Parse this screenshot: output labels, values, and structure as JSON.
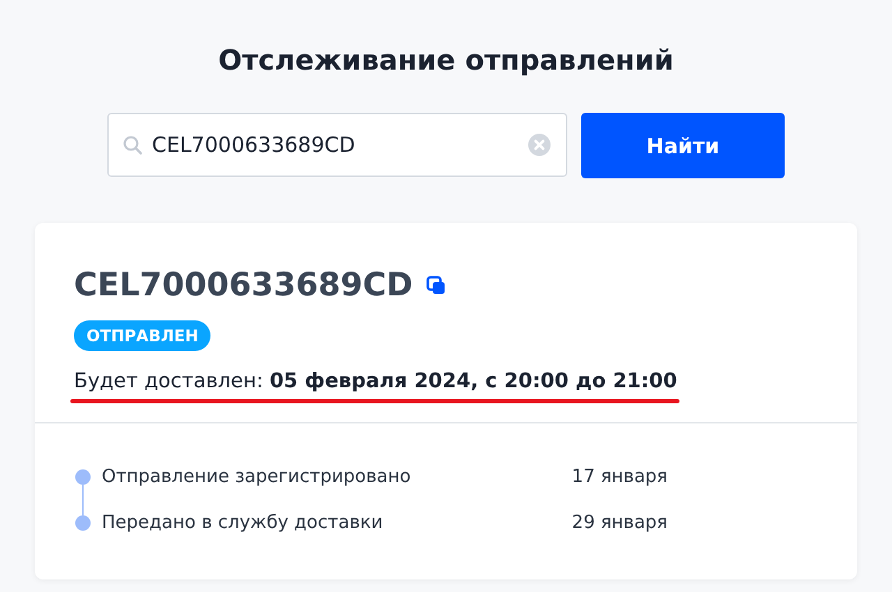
{
  "title": "Отслеживание отправлений",
  "search": {
    "value": "CEL7000633689CD",
    "button": "Найти"
  },
  "shipment": {
    "number": "CEL7000633689CD",
    "status": "ОТПРАВЛЕН",
    "delivery_label": "Будет доставлен:",
    "delivery_value": "05 февраля 2024, с 20:00 до 21:00"
  },
  "events": [
    {
      "text": "Отправление зарегистрировано",
      "date": "17 января"
    },
    {
      "text": "Передано в службу доставки",
      "date": "29 января"
    }
  ]
}
